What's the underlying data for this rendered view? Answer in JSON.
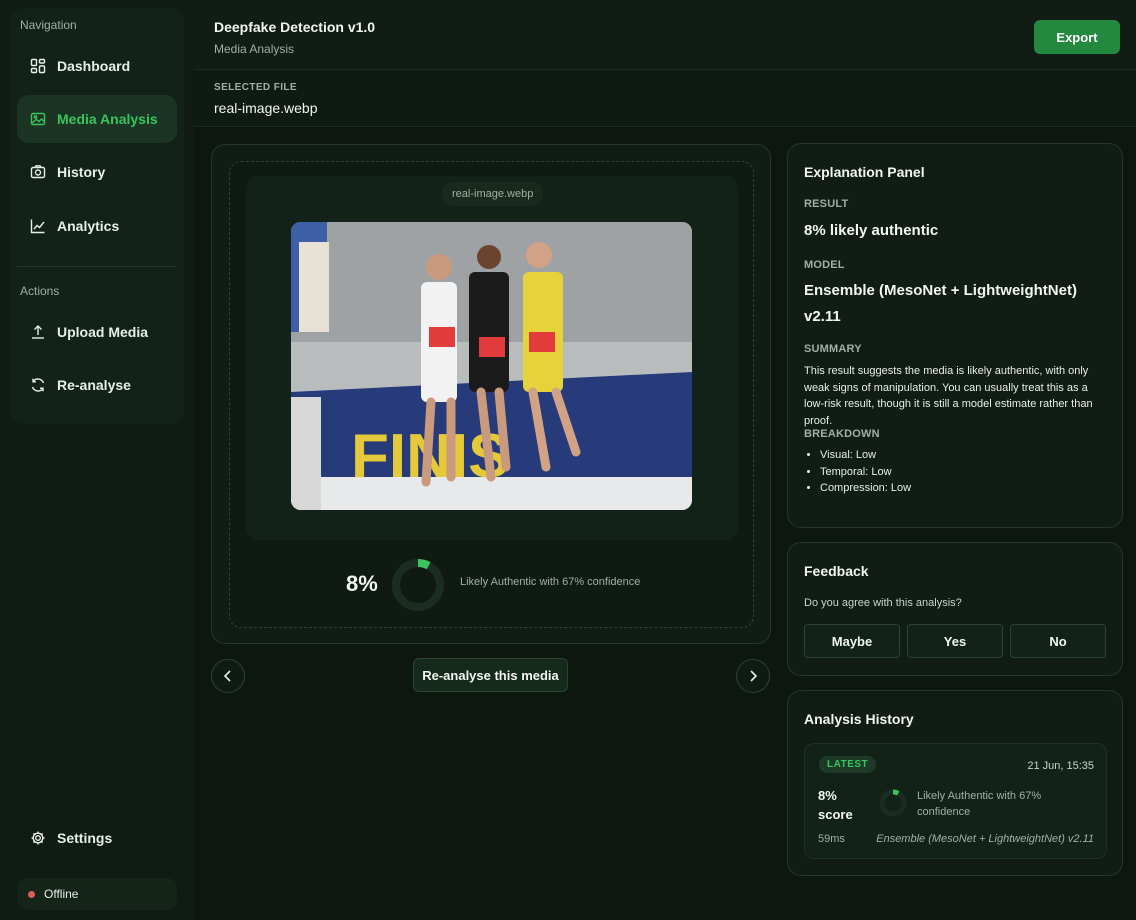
{
  "sidebar": {
    "nav_label": "Navigation",
    "items": [
      {
        "label": "Dashboard"
      },
      {
        "label": "Media Analysis"
      },
      {
        "label": "History"
      },
      {
        "label": "Analytics"
      }
    ],
    "actions_label": "Actions",
    "actions": [
      {
        "label": "Upload Media"
      },
      {
        "label": "Re-analyse"
      }
    ],
    "settings_label": "Settings",
    "status_label": "Offline",
    "active_color": "#38c45e",
    "status_color": "#e05c5c"
  },
  "header": {
    "title": "Deepfake Detection v1.0",
    "subtitle": "Media Analysis",
    "export_label": "Export",
    "export_color": "#22893e"
  },
  "file": {
    "label": "SELECTED FILE",
    "name": "real-image.webp"
  },
  "preview": {
    "chip": "real-image.webp",
    "score": "8%",
    "score_fraction": 0.08,
    "verdict": "Likely Authentic with 67% confidence",
    "prev_icon": "chevron-left-icon",
    "next_icon": "chevron-right-icon",
    "reanalyse_label": "Re-analyse this media"
  },
  "explanation": {
    "title": "Explanation Panel",
    "result_label": "RESULT",
    "result_value": "8% likely authentic",
    "model_label": "MODEL",
    "model_value": "Ensemble (MesoNet + LightweightNet) v2.11",
    "summary_label": "SUMMARY",
    "summary_text": "This result suggests the media is likely authentic, with only weak signs of manipulation. You can usually treat this as a low-risk result, though it is still a model estimate rather than proof.",
    "breakdown_label": "BREAKDOWN",
    "breakdown": [
      "Visual: Low",
      "Temporal: Low",
      "Compression: Low"
    ]
  },
  "feedback": {
    "title": "Feedback",
    "question": "Do you agree with this analysis?",
    "buttons": [
      "Maybe",
      "Yes",
      "No"
    ]
  },
  "history": {
    "title": "Analysis History",
    "entries": [
      {
        "badge": "LATEST",
        "date": "21 Jun, 15:35",
        "score": "8% score",
        "score_fraction": 0.08,
        "verdict": "Likely Authentic with 67% confidence",
        "duration": "59ms",
        "model": "Ensemble (MesoNet + LightweightNet) v2.11"
      }
    ]
  }
}
